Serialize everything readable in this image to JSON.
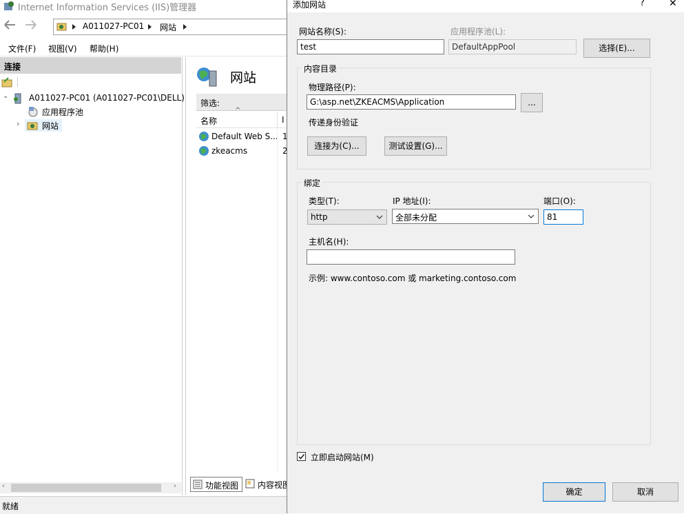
{
  "iis": {
    "title": "Internet Information Services (IIS)管理器",
    "breadcrumb": [
      "A011027-PC01",
      "网站"
    ],
    "menu": [
      "文件(F)",
      "视图(V)",
      "帮助(H)"
    ],
    "connections_label": "连接",
    "tree": {
      "server": "A011027-PC01 (A011027-PC01\\DELL)",
      "app_pools": "应用程序池",
      "sites": "网站"
    },
    "sites_title": "网站",
    "filter_label": "筛选:",
    "col_name": "名称",
    "col_id": "I",
    "sites": [
      {
        "name": "Default Web S...",
        "id": "1"
      },
      {
        "name": "zkeacms",
        "id": "2"
      }
    ],
    "view_tabs": {
      "features": "功能视图",
      "content": "内容视图"
    },
    "status": "就绪"
  },
  "dialog": {
    "title": "添加网站",
    "help": "?",
    "close": "✕",
    "site_name_label": "网站名称(S):",
    "site_name_value": "test",
    "app_pool_label": "应用程序池(L):",
    "app_pool_value": "DefaultAppPool",
    "select_button": "选择(E)...",
    "content_dir_title": "内容目录",
    "physical_path_label": "物理路径(P):",
    "physical_path_value": "G:\\asp.net\\ZKEACMS\\Application",
    "browse_button": "...",
    "pass_through_label": "传递身份验证",
    "connect_as_button": "连接为(C)...",
    "test_settings_button": "测试设置(G)...",
    "binding_title": "绑定",
    "type_label": "类型(T):",
    "type_value": "http",
    "ip_label": "IP 地址(I):",
    "ip_value": "全部未分配",
    "port_label": "端口(O):",
    "port_value": "81",
    "host_label": "主机名(H):",
    "host_value": "",
    "example_text": "示例: www.contoso.com 或 marketing.contoso.com",
    "start_now_label": "立即启动网站(M)",
    "start_now_checked": true,
    "ok_button": "确定",
    "cancel_button": "取消"
  }
}
